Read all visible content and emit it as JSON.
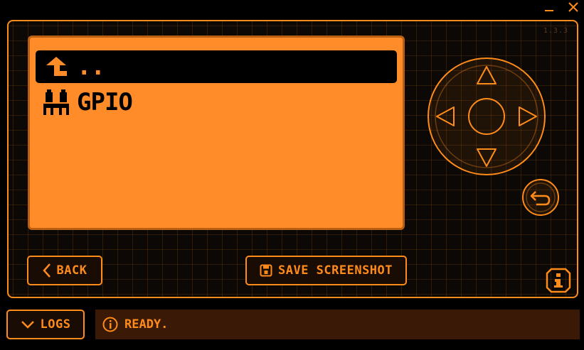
{
  "window": {
    "controls": [
      {
        "name": "minimize",
        "icon": "minimize-icon"
      },
      {
        "name": "close",
        "icon": "close-icon"
      }
    ]
  },
  "device": {
    "version": "1.3.3",
    "screen": {
      "items": [
        {
          "label": "..",
          "icon": "up-arrow-icon",
          "selected": true
        },
        {
          "label": "GPIO",
          "icon": "gpio-icon",
          "selected": false
        }
      ]
    },
    "buttons": {
      "back": "BACK",
      "save_screenshot": "SAVE SCREENSHOT"
    },
    "dpad": {
      "icons": [
        "up-arrow-icon",
        "down-arrow-icon",
        "left-arrow-icon",
        "right-arrow-icon",
        "ok-button"
      ]
    },
    "return_icon": "return-icon",
    "info_icon": "info-icon"
  },
  "bottom": {
    "logs": "LOGS",
    "status": "READY."
  },
  "colors": {
    "accent": "#ff8c1a",
    "screen": "#ff8c28",
    "background": "#000000",
    "status_bg": "#3a1a06"
  }
}
